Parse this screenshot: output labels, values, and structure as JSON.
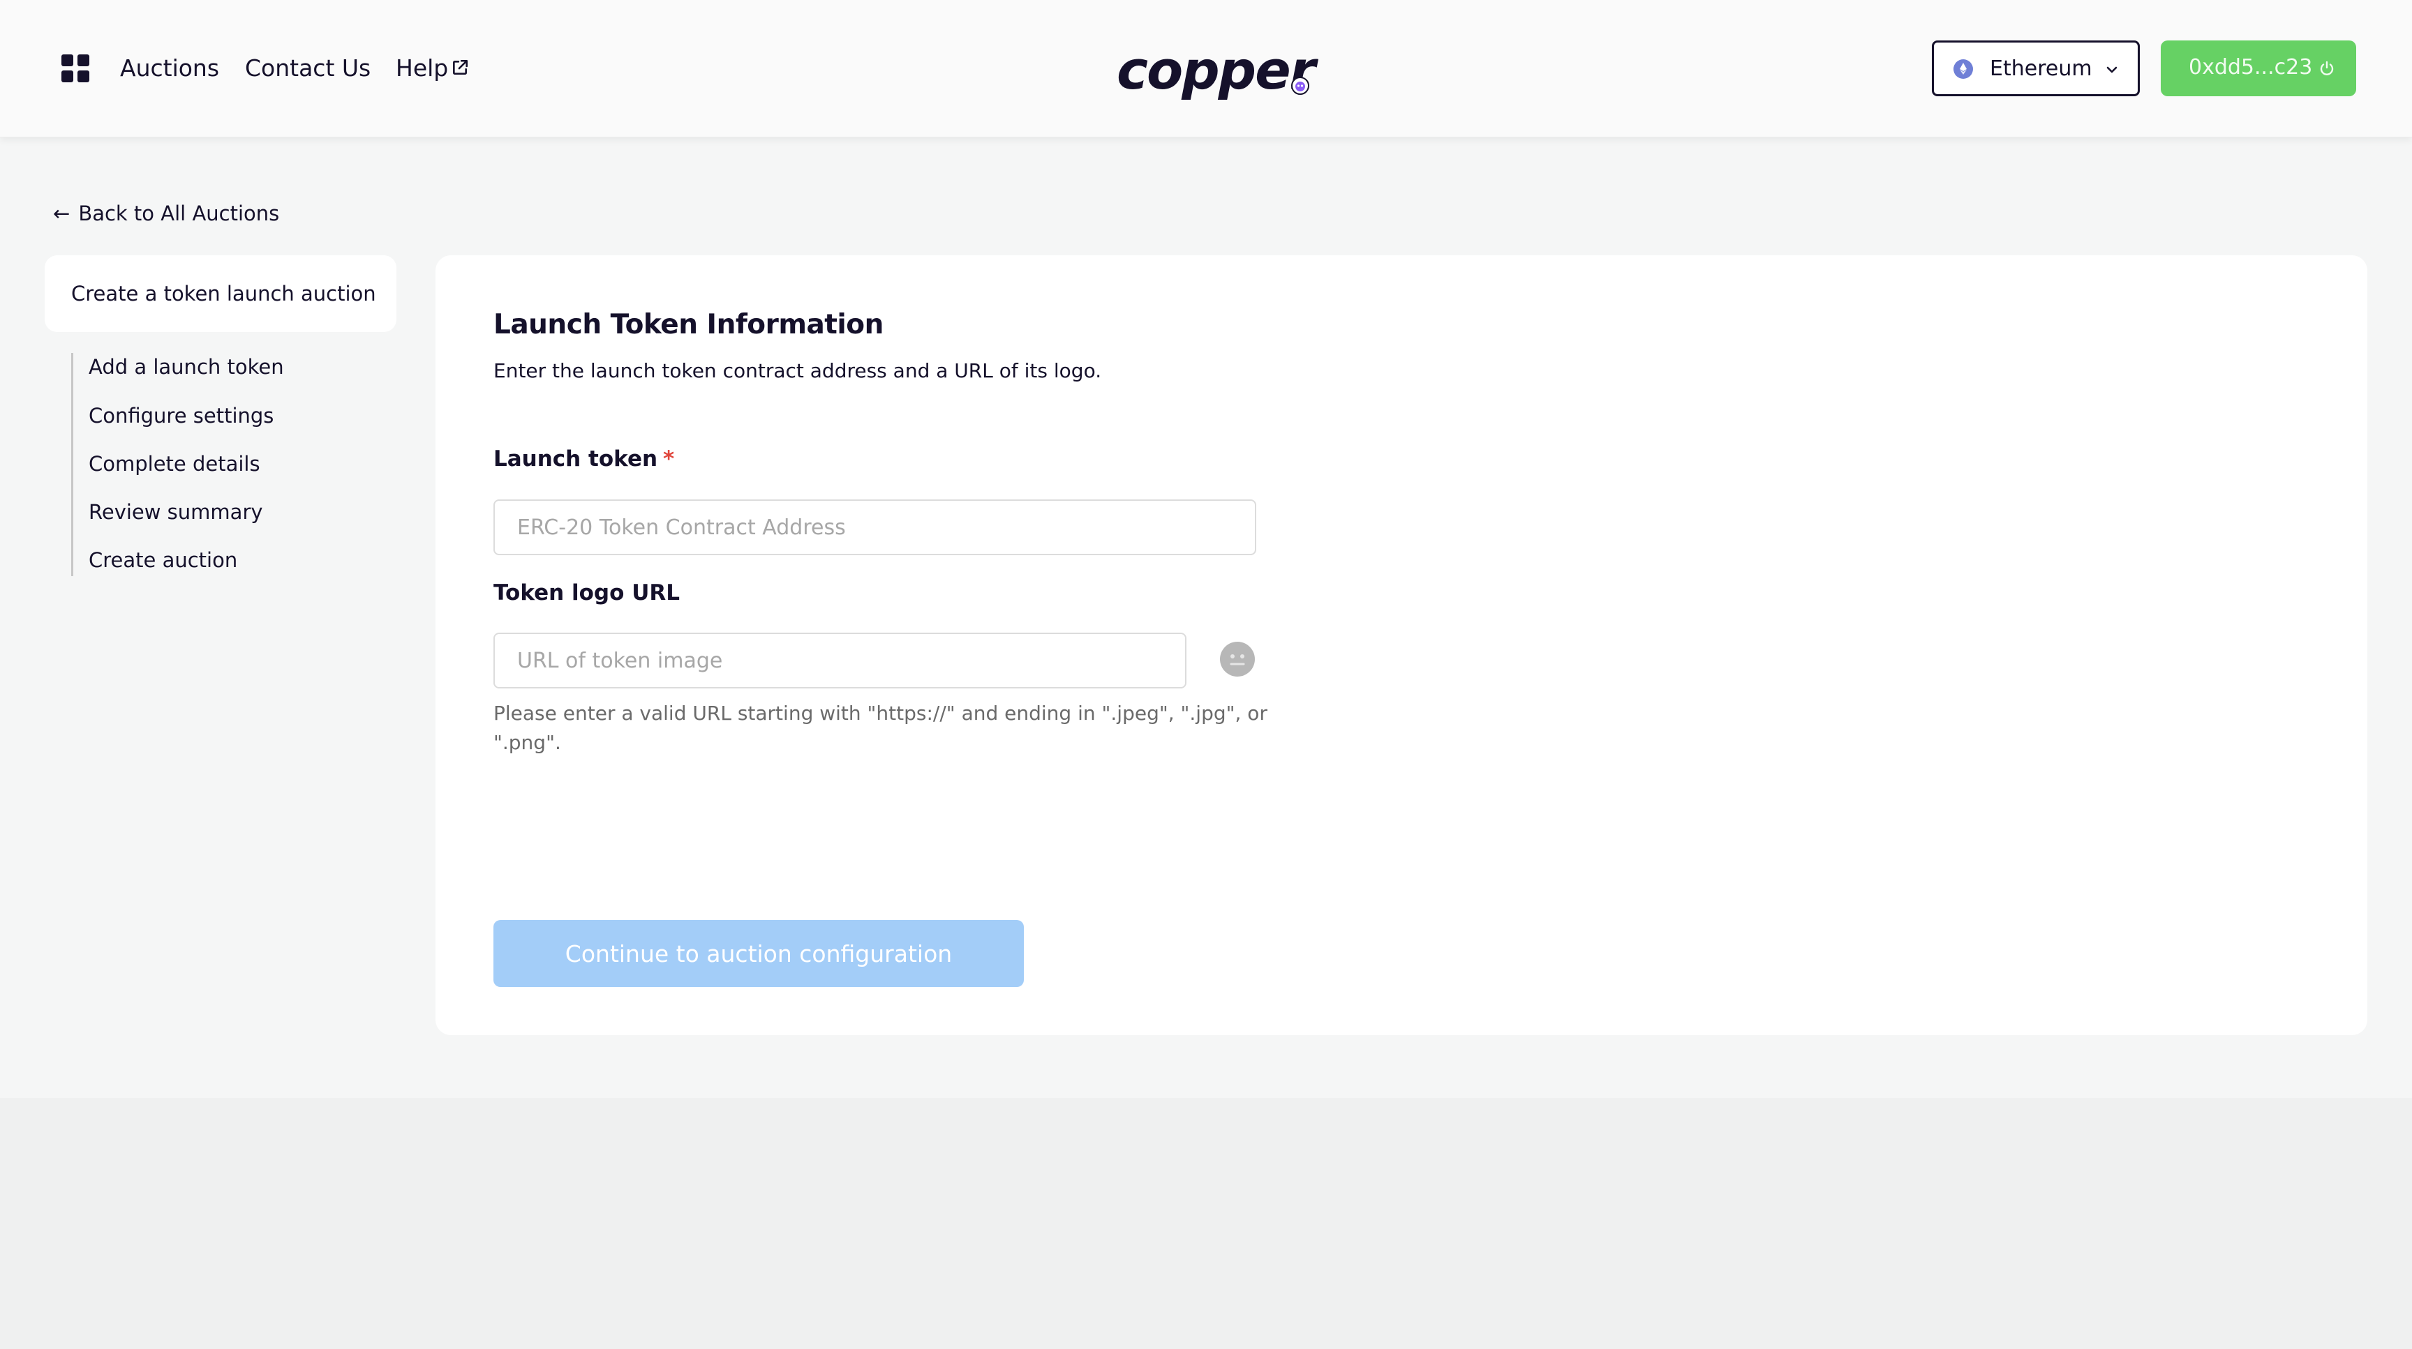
{
  "header": {
    "apps_icon": "grid-icon",
    "nav": [
      {
        "label": "Auctions"
      },
      {
        "label": "Contact Us"
      },
      {
        "label": "Help",
        "icon": "external-link-icon"
      }
    ],
    "logo_text": "copper",
    "network": {
      "label": "Ethereum",
      "icon": "ethereum-icon"
    },
    "wallet": {
      "label": "0xdd5...c23",
      "icon": "power-icon",
      "color": "#66d164"
    }
  },
  "back_link": {
    "label": "Back to All Auctions"
  },
  "sidebar": {
    "title": "Create a token launch auction",
    "steps": [
      {
        "label": "Add a launch token"
      },
      {
        "label": "Configure settings"
      },
      {
        "label": "Complete details"
      },
      {
        "label": "Review summary"
      },
      {
        "label": "Create auction"
      }
    ]
  },
  "main": {
    "title": "Launch Token Information",
    "description": "Enter the launch token contract address and a URL of its logo.",
    "launch_token": {
      "label": "Launch token",
      "required_mark": "*",
      "placeholder": "ERC-20 Token Contract Address",
      "value": ""
    },
    "token_logo": {
      "label": "Token logo URL",
      "placeholder": "URL of token image",
      "value": "",
      "help": "Please enter a valid URL starting with \"https://\" and ending in \".jpeg\", \".jpg\", or \".png\"."
    },
    "continue_button": {
      "label": "Continue to auction configuration",
      "color": "#a3cdf8"
    }
  }
}
